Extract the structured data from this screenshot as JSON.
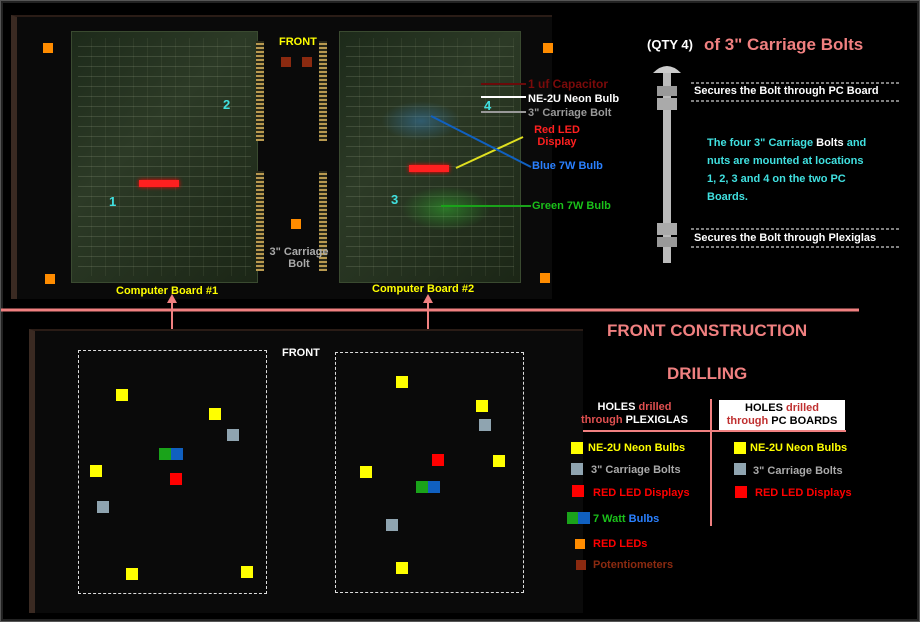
{
  "colors": {
    "neon": "#ffff00",
    "bolt": "#8fa4b0",
    "led_display": "#ff0000",
    "green_bulb": "#1aa31a",
    "blue_bulb": "#1060c0",
    "red_led": "#ff8c00",
    "pot": "#8b2a10",
    "divider": "#f08080",
    "title": "#f08080"
  },
  "top": {
    "front_label": "FRONT",
    "board1_label": "Computer Board #1",
    "board2_label": "Computer Board #2",
    "carriage_bolt_label": "3\" Carriage Bolt",
    "callouts": {
      "capacitor": "1 uf Capacitor",
      "neon": "NE-2U Neon Bulb",
      "bolt": "3\" Carriage Bolt",
      "red_led": "Red LED Display",
      "blue": "Blue 7W Bulb",
      "green": "Green 7W Bulb"
    },
    "location_numbers": [
      "1",
      "2",
      "3",
      "4"
    ]
  },
  "bolt_panel": {
    "qty": "(QTY 4)",
    "title": "of 3\" Carriage Bolts",
    "top_note": "Secures the Bolt through PC Board",
    "bottom_note": "Secures  the Bolt through Plexiglas",
    "description_a": "The four 3\" Carriage ",
    "description_b": "Bolts",
    "description_c": " and nuts are mounted at locations 1, 2, 3 and 4 on the two PC Boards."
  },
  "bottom": {
    "title": "FRONT  CONSTRUCTION",
    "subtitle": "DRILLING",
    "front_label": "FRONT",
    "plexi_header": {
      "a": "HOLES ",
      "b": "drilled",
      "c": "through ",
      "d": "PLEXIGLAS"
    },
    "pcb_header": {
      "a": "HOLES ",
      "b": "drilled",
      "c": "through ",
      "d": "PC BOARDS"
    },
    "plexi_legend": [
      "NE-2U Neon Bulbs",
      "3\" Carriage Bolts",
      "RED LED Displays"
    ],
    "watt_a": "7 Watt ",
    "watt_b": "Bulbs",
    "pcb_legend": [
      "NE-2U Neon Bulbs",
      "3\" Carriage Bolts",
      "RED LED Displays"
    ],
    "extra_legend": [
      "RED LEDs",
      "Potentiometers"
    ]
  }
}
